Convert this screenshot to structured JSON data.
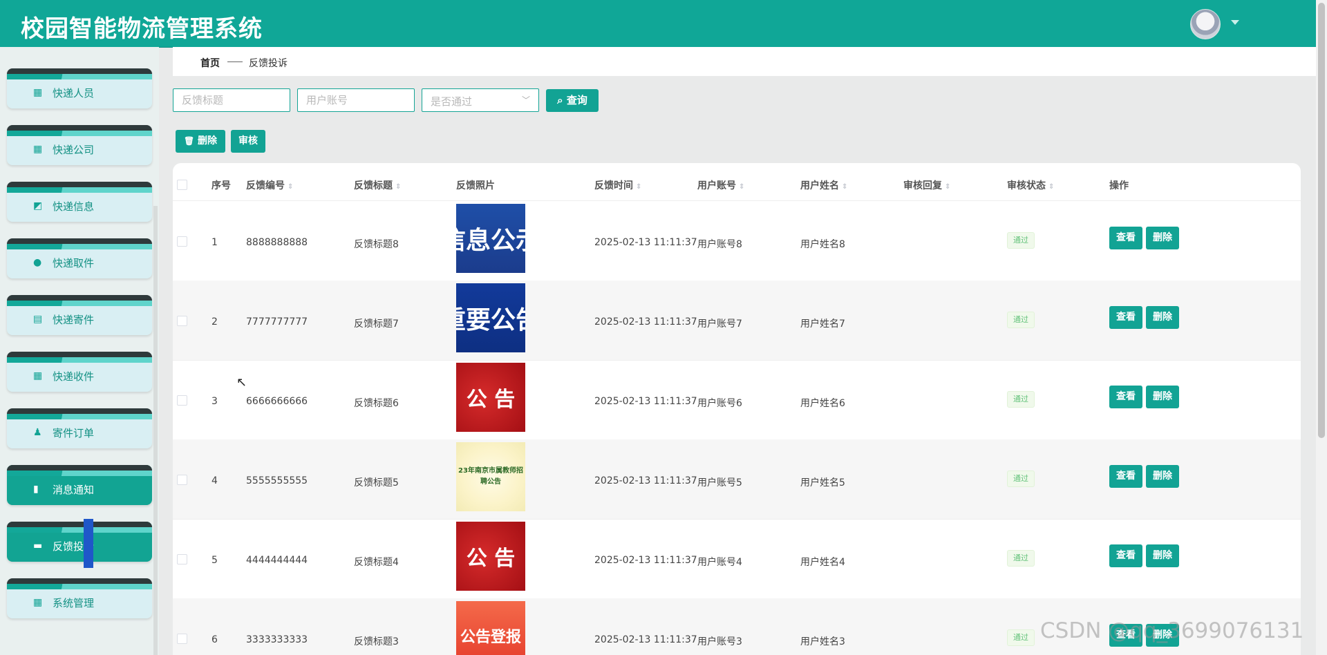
{
  "app": {
    "title": "校园智能物流管理系统"
  },
  "breadcrumb": {
    "home": "首页",
    "current": "反馈投诉"
  },
  "sidebar": {
    "items": [
      {
        "label": "快递人员",
        "icon": "grid-icon",
        "glyph": "▦",
        "active": false
      },
      {
        "label": "快递公司",
        "icon": "grid-icon",
        "glyph": "▦",
        "active": false
      },
      {
        "label": "快递信息",
        "icon": "chart-icon",
        "glyph": "◩",
        "active": false
      },
      {
        "label": "快递取件",
        "icon": "lightbulb-icon",
        "glyph": "●",
        "active": false
      },
      {
        "label": "快递寄件",
        "icon": "clipboard-icon",
        "glyph": "▤",
        "active": false
      },
      {
        "label": "快递收件",
        "icon": "grid-icon",
        "glyph": "▦",
        "active": false
      },
      {
        "label": "寄件订单",
        "icon": "user-icon",
        "glyph": "♟",
        "active": false
      },
      {
        "label": "消息通知",
        "icon": "bar-chart-icon",
        "glyph": "▮",
        "active": true
      },
      {
        "label": "反馈投诉",
        "icon": "briefcase-icon",
        "glyph": "▬",
        "active": true
      },
      {
        "label": "系统管理",
        "icon": "grid-icon",
        "glyph": "▦",
        "active": false
      }
    ]
  },
  "search": {
    "title_placeholder": "反馈标题",
    "account_placeholder": "用户账号",
    "status_placeholder": "是否通过",
    "query_label": "查询"
  },
  "toolbar": {
    "delete_label": "删除",
    "audit_label": "审核"
  },
  "table": {
    "headers": [
      "序号",
      "反馈编号",
      "反馈标题",
      "反馈照片",
      "反馈时间",
      "用户账号",
      "用户姓名",
      "审核回复",
      "审核状态",
      "操作"
    ],
    "view_label": "查看",
    "delete_label": "删除",
    "rows": [
      {
        "index": "1",
        "code": "8888888888",
        "title": "反馈标题8",
        "photo_text": "信息公示",
        "photo_style": "t-blue",
        "time": "2025-02-13 11:11:37",
        "account": "用户账号8",
        "name": "用户姓名8",
        "reply": "",
        "status": "通过"
      },
      {
        "index": "2",
        "code": "7777777777",
        "title": "反馈标题7",
        "photo_text": "重要公告",
        "photo_style": "t-navy",
        "time": "2025-02-13 11:11:37",
        "account": "用户账号7",
        "name": "用户姓名7",
        "reply": "",
        "status": "通过"
      },
      {
        "index": "3",
        "code": "6666666666",
        "title": "反馈标题6",
        "photo_text": "公 告",
        "photo_style": "t-red",
        "time": "2025-02-13 11:11:37",
        "account": "用户账号6",
        "name": "用户姓名6",
        "reply": "",
        "status": "通过"
      },
      {
        "index": "4",
        "code": "5555555555",
        "title": "反馈标题5",
        "photo_text": "23年南京市属教师招聘公告",
        "photo_style": "t-paper",
        "time": "2025-02-13 11:11:37",
        "account": "用户账号5",
        "name": "用户姓名5",
        "reply": "",
        "status": "通过"
      },
      {
        "index": "5",
        "code": "4444444444",
        "title": "反馈标题4",
        "photo_text": "公 告",
        "photo_style": "t-red",
        "time": "2025-02-13 11:11:37",
        "account": "用户账号4",
        "name": "用户姓名4",
        "reply": "",
        "status": "通过"
      },
      {
        "index": "6",
        "code": "3333333333",
        "title": "反馈标题3",
        "photo_text": "公告登报",
        "photo_style": "t-orange",
        "time": "2025-02-13 11:11:37",
        "account": "用户账号3",
        "name": "用户姓名3",
        "reply": "",
        "status": "通过"
      }
    ]
  },
  "watermark": "CSDN @qq_3699076131",
  "colors": {
    "primary": "#12a394",
    "header": "#10a797"
  }
}
